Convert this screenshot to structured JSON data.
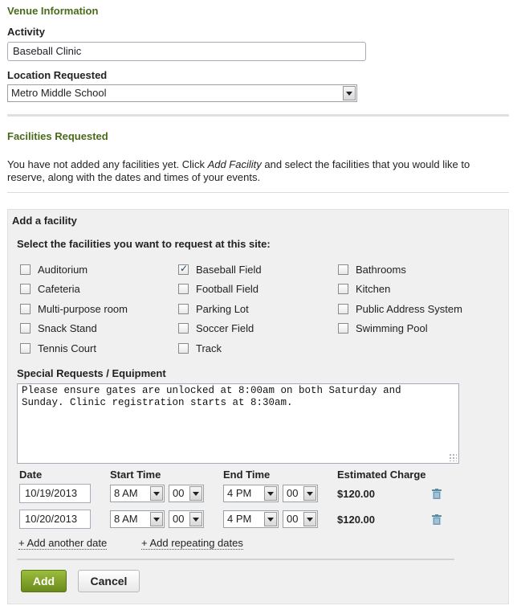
{
  "venue": {
    "section_title": "Venue Information",
    "activity_label": "Activity",
    "activity_value": "Baseball Clinic",
    "location_label": "Location Requested",
    "location_value": "Metro Middle School"
  },
  "facilities": {
    "section_title": "Facilities Requested",
    "intro_prefix": "You have not added any facilities yet. Click ",
    "intro_link": "Add Facility",
    "intro_suffix": " and select the facilities that you would like to reserve, along with the dates and times of your events."
  },
  "add_panel": {
    "title": "Add a facility",
    "instruction": "Select the facilities you want to request at this site:",
    "checkboxes": [
      {
        "label": "Auditorium",
        "checked": false
      },
      {
        "label": "Baseball Field",
        "checked": true
      },
      {
        "label": "Bathrooms",
        "checked": false
      },
      {
        "label": "Cafeteria",
        "checked": false
      },
      {
        "label": "Football Field",
        "checked": false
      },
      {
        "label": "Kitchen",
        "checked": false
      },
      {
        "label": "Multi-purpose room",
        "checked": false
      },
      {
        "label": "Parking Lot",
        "checked": false
      },
      {
        "label": "Public Address System",
        "checked": false
      },
      {
        "label": "Snack Stand",
        "checked": false
      },
      {
        "label": "Soccer Field",
        "checked": false
      },
      {
        "label": "Swimming Pool",
        "checked": false
      },
      {
        "label": "Tennis Court",
        "checked": false
      },
      {
        "label": "Track",
        "checked": false
      }
    ],
    "special_label": "Special Requests / Equipment",
    "special_text": "Please ensure gates are unlocked at 8:00am on both Saturday and\nSunday. Clinic registration starts at 8:30am.",
    "headers": {
      "date": "Date",
      "start": "Start Time",
      "end": "End Time",
      "charge": "Estimated Charge"
    },
    "rows": [
      {
        "date": "10/19/2013",
        "start_hour": "8 AM",
        "start_min": "00",
        "end_hour": "4 PM",
        "end_min": "00",
        "charge": "$120.00"
      },
      {
        "date": "10/20/2013",
        "start_hour": "8 AM",
        "start_min": "00",
        "end_hour": "4 PM",
        "end_min": "00",
        "charge": "$120.00"
      }
    ],
    "add_another_date": "+ Add another date",
    "add_repeating": "+ Add repeating dates",
    "add_button": "Add",
    "cancel_button": "Cancel"
  },
  "colors": {
    "section_title": "#4a6a1a",
    "add_button": "#7f9e28"
  },
  "icons": {
    "row_delete": "trash-icon",
    "select_toggle": "chevron-down-icon"
  }
}
